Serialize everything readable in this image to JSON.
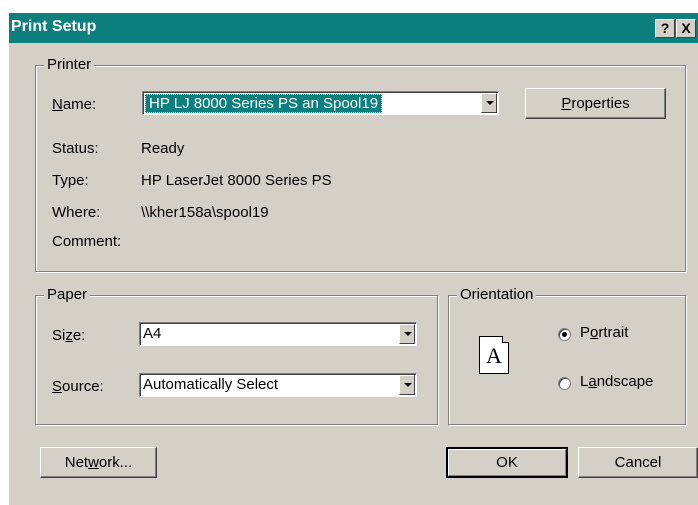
{
  "window": {
    "title": "Print Setup",
    "help_glyph": "?",
    "close_glyph": "X"
  },
  "printer": {
    "legend": "Printer",
    "name_label": "Name:",
    "name_value": "HP LJ 8000 Series PS an Spool19",
    "properties_label": "Properties",
    "status_label": "Status:",
    "status_value": "Ready",
    "type_label": "Type:",
    "type_value": "HP LaserJet 8000 Series PS",
    "where_label": "Where:",
    "where_value": "\\\\kher158a\\spool19",
    "comment_label": "Comment:",
    "comment_value": ""
  },
  "paper": {
    "legend": "Paper",
    "size_label": "Size:",
    "size_value": "A4",
    "source_label": "Source:",
    "source_value": "Automatically Select"
  },
  "orientation": {
    "legend": "Orientation",
    "icon_letter": "A",
    "portrait_label": "Portrait",
    "portrait_selected": true,
    "landscape_label": "Landscape",
    "landscape_selected": false
  },
  "buttons": {
    "network": "Network...",
    "ok": "OK",
    "cancel": "Cancel"
  },
  "colors": {
    "titlebar": "#0e7f7f",
    "face": "#d4d0c8"
  }
}
